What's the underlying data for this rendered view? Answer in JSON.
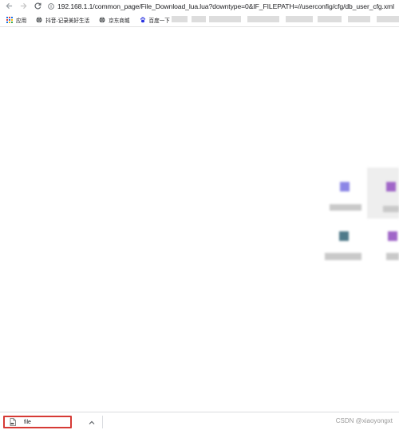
{
  "browser": {
    "back_icon": "arrow-left-icon",
    "forward_icon": "arrow-right-icon",
    "reload_icon": "reload-icon",
    "url": "192.168.1.1/common_page/File_Download_lua.lua?downtype=0&IF_FILEPATH=//userconfig/cfg/db_user_cfg.xml"
  },
  "bookmarks": [
    {
      "label": "应用",
      "icon": "apps-grid-icon"
    },
    {
      "label": "抖音-记录美好生活",
      "icon": "globe-icon"
    },
    {
      "label": "京东商城",
      "icon": "globe-icon"
    },
    {
      "label": "百度一下",
      "icon": "baidu-paw-icon"
    }
  ],
  "download_shelf": {
    "item_name": "file",
    "item_icon": "file-icon",
    "chevron_icon": "chevron-up-icon",
    "highlight_color": "#d63a35"
  },
  "watermark": "CSDN @xiaoyongxt"
}
